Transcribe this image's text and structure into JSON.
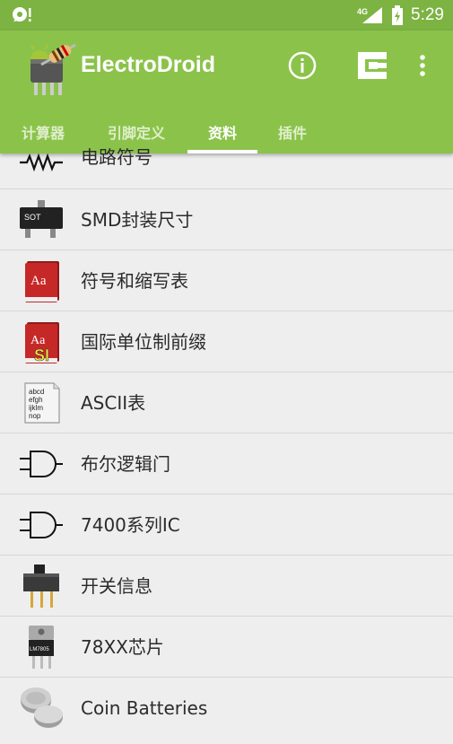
{
  "status_bar": {
    "network": "4G",
    "time": "5:29"
  },
  "app": {
    "title": "ElectroDroid"
  },
  "tabs": [
    {
      "label": "计算器",
      "active": false
    },
    {
      "label": "引脚定义",
      "active": false
    },
    {
      "label": "资料",
      "active": true
    },
    {
      "label": "插件",
      "active": false
    }
  ],
  "items": [
    {
      "label": "电路符号",
      "icon": "resistor-symbol-icon"
    },
    {
      "label": "SMD封装尺寸",
      "icon": "sot-chip-icon",
      "icon_text": "SOT"
    },
    {
      "label": "符号和缩写表",
      "icon": "dictionary-book-icon",
      "icon_text": "Aa"
    },
    {
      "label": "国际单位制前缀",
      "icon": "si-book-icon",
      "icon_text": "Aa",
      "icon_badge": "SI"
    },
    {
      "label": "ASCII表",
      "icon": "ascii-page-icon",
      "icon_lines": [
        "abcd",
        "efgh",
        "ijklm",
        "nop"
      ]
    },
    {
      "label": "布尔逻辑门",
      "icon": "and-gate-icon"
    },
    {
      "label": "7400系列IC",
      "icon": "and-gate-icon"
    },
    {
      "label": "开关信息",
      "icon": "slide-switch-icon"
    },
    {
      "label": "78XX芯片",
      "icon": "regulator-chip-icon",
      "icon_text": "LM7805"
    },
    {
      "label": "Coin Batteries",
      "icon": "coin-battery-icon"
    }
  ],
  "colors": {
    "status_bar": "#7cb342",
    "app_bar": "#8bc34a",
    "list_bg": "#eeeeee"
  }
}
